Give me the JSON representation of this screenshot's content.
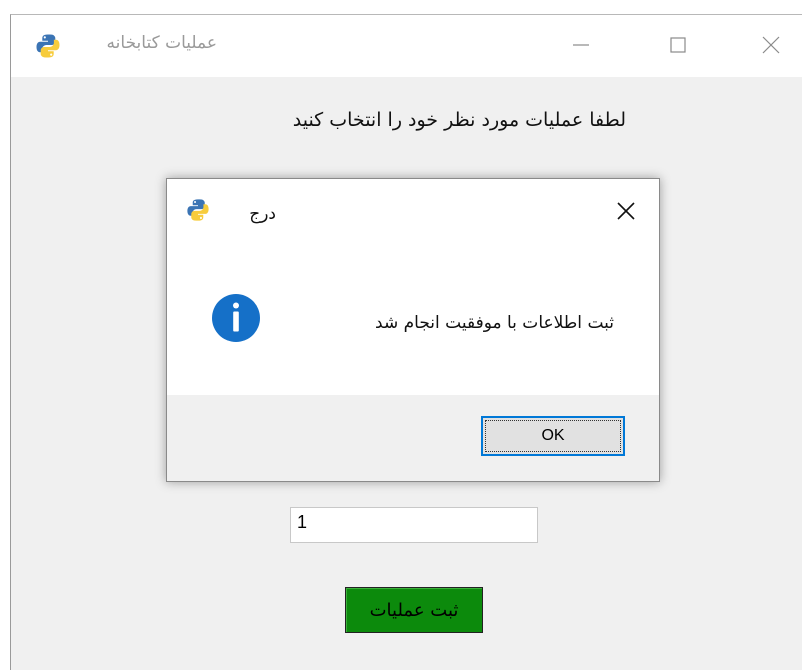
{
  "main_window": {
    "title": "عملیات کتابخانه",
    "prompt": "لطفا عملیات مورد نظر خود را انتخاب کنید",
    "input_value": "1",
    "submit_label": "ثبت عملیات"
  },
  "dialog": {
    "title": "درج",
    "message": "ثبت اطلاعات با موفقیت انجام شد",
    "ok_label": "OK"
  },
  "icons": {
    "app": "python-logo-icon",
    "info": "info-icon",
    "minimize": "minimize-icon",
    "maximize": "maximize-icon",
    "close": "close-icon"
  },
  "colors": {
    "submit_button": "#0c8a0c",
    "info_icon": "#1570c8",
    "ok_focus_border": "#0078d7"
  }
}
